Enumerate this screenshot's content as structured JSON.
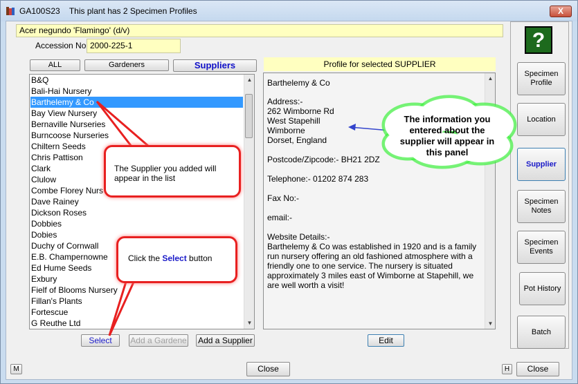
{
  "window": {
    "id": "GA100S23",
    "title": "This plant has 2 Specimen Profiles",
    "close_symbol": "X"
  },
  "plant_name": "Acer negundo 'Flamingo' (d/v)",
  "accession": {
    "label": "Accession No",
    "value": "2000-225-1"
  },
  "tabs": {
    "all": "ALL",
    "gardeners": "Gardeners",
    "suppliers": "Suppliers"
  },
  "supplier_list": [
    "B&Q",
    "Bali-Hai Nursery",
    "Barthelemy & Co",
    "Bay View Nursery",
    "Bernaville Nurseries",
    "Burncoose Nurseries",
    "Chiltern Seeds",
    "Chris Pattison",
    "Clark",
    "Clulow",
    "Combe Florey Nurs",
    "Dave Rainey",
    "Dickson Roses",
    "Dobbies",
    "Dobies",
    "Duchy of Cornwall",
    "E.B. Champernowne",
    "Ed Hume Seeds",
    "Exbury",
    "Fielf of Blooms Nursery",
    "Fillan's Plants",
    "Fortescue",
    "G Reuthe Ltd"
  ],
  "selected_supplier_index": 2,
  "list_buttons": {
    "select": "Select",
    "add_gardener": "Add a Gardene",
    "add_supplier": "Add a Supplier"
  },
  "profile": {
    "header": "Profile for selected SUPPLIER",
    "name": "Barthelemy & Co",
    "address_label": "Address:-",
    "address_lines": [
      "262 Wimborne Rd",
      "West Stapehill",
      "Wimborne",
      "Dorset, England"
    ],
    "postcode": "Postcode/Zipcode:- BH21 2DZ",
    "telephone": "Telephone:- 01202 874 283",
    "fax": "Fax No:-",
    "email": "email:-",
    "website_label": "Website Details:-",
    "website_lines": [
      "Barthelemy & Co was established in 1920 and is a family",
      "run nursery offering an old fashioned atmosphere with a",
      "friendly one to one service. The nursery is situated",
      "approximately 3 miles east of Wimborne at Stapehill, we",
      "are well worth a visit!"
    ],
    "edit_label": "Edit"
  },
  "sidebar": {
    "help_symbol": "?",
    "buttons": [
      "Specimen Profile",
      "Location",
      "Supplier",
      "Specimen Notes",
      "Specimen Events",
      "Pot History",
      "Batch"
    ],
    "active": "Supplier"
  },
  "footer": {
    "m": "M",
    "h": "H",
    "close": "Close"
  },
  "callouts": {
    "list_tip": "The Supplier you added will appear in the list",
    "select_tip_pre": "Click the ",
    "select_tip_bold": "Select",
    "select_tip_post": " button",
    "cloud_tip": "The information you entered about the supplier will appear in this panel"
  },
  "colors": {
    "accent": "#1a1ac8",
    "field_bg": "#ffffc0",
    "selection": "#3399ff",
    "callout_border": "#e82020",
    "cloud_glow": "#3df03d"
  }
}
